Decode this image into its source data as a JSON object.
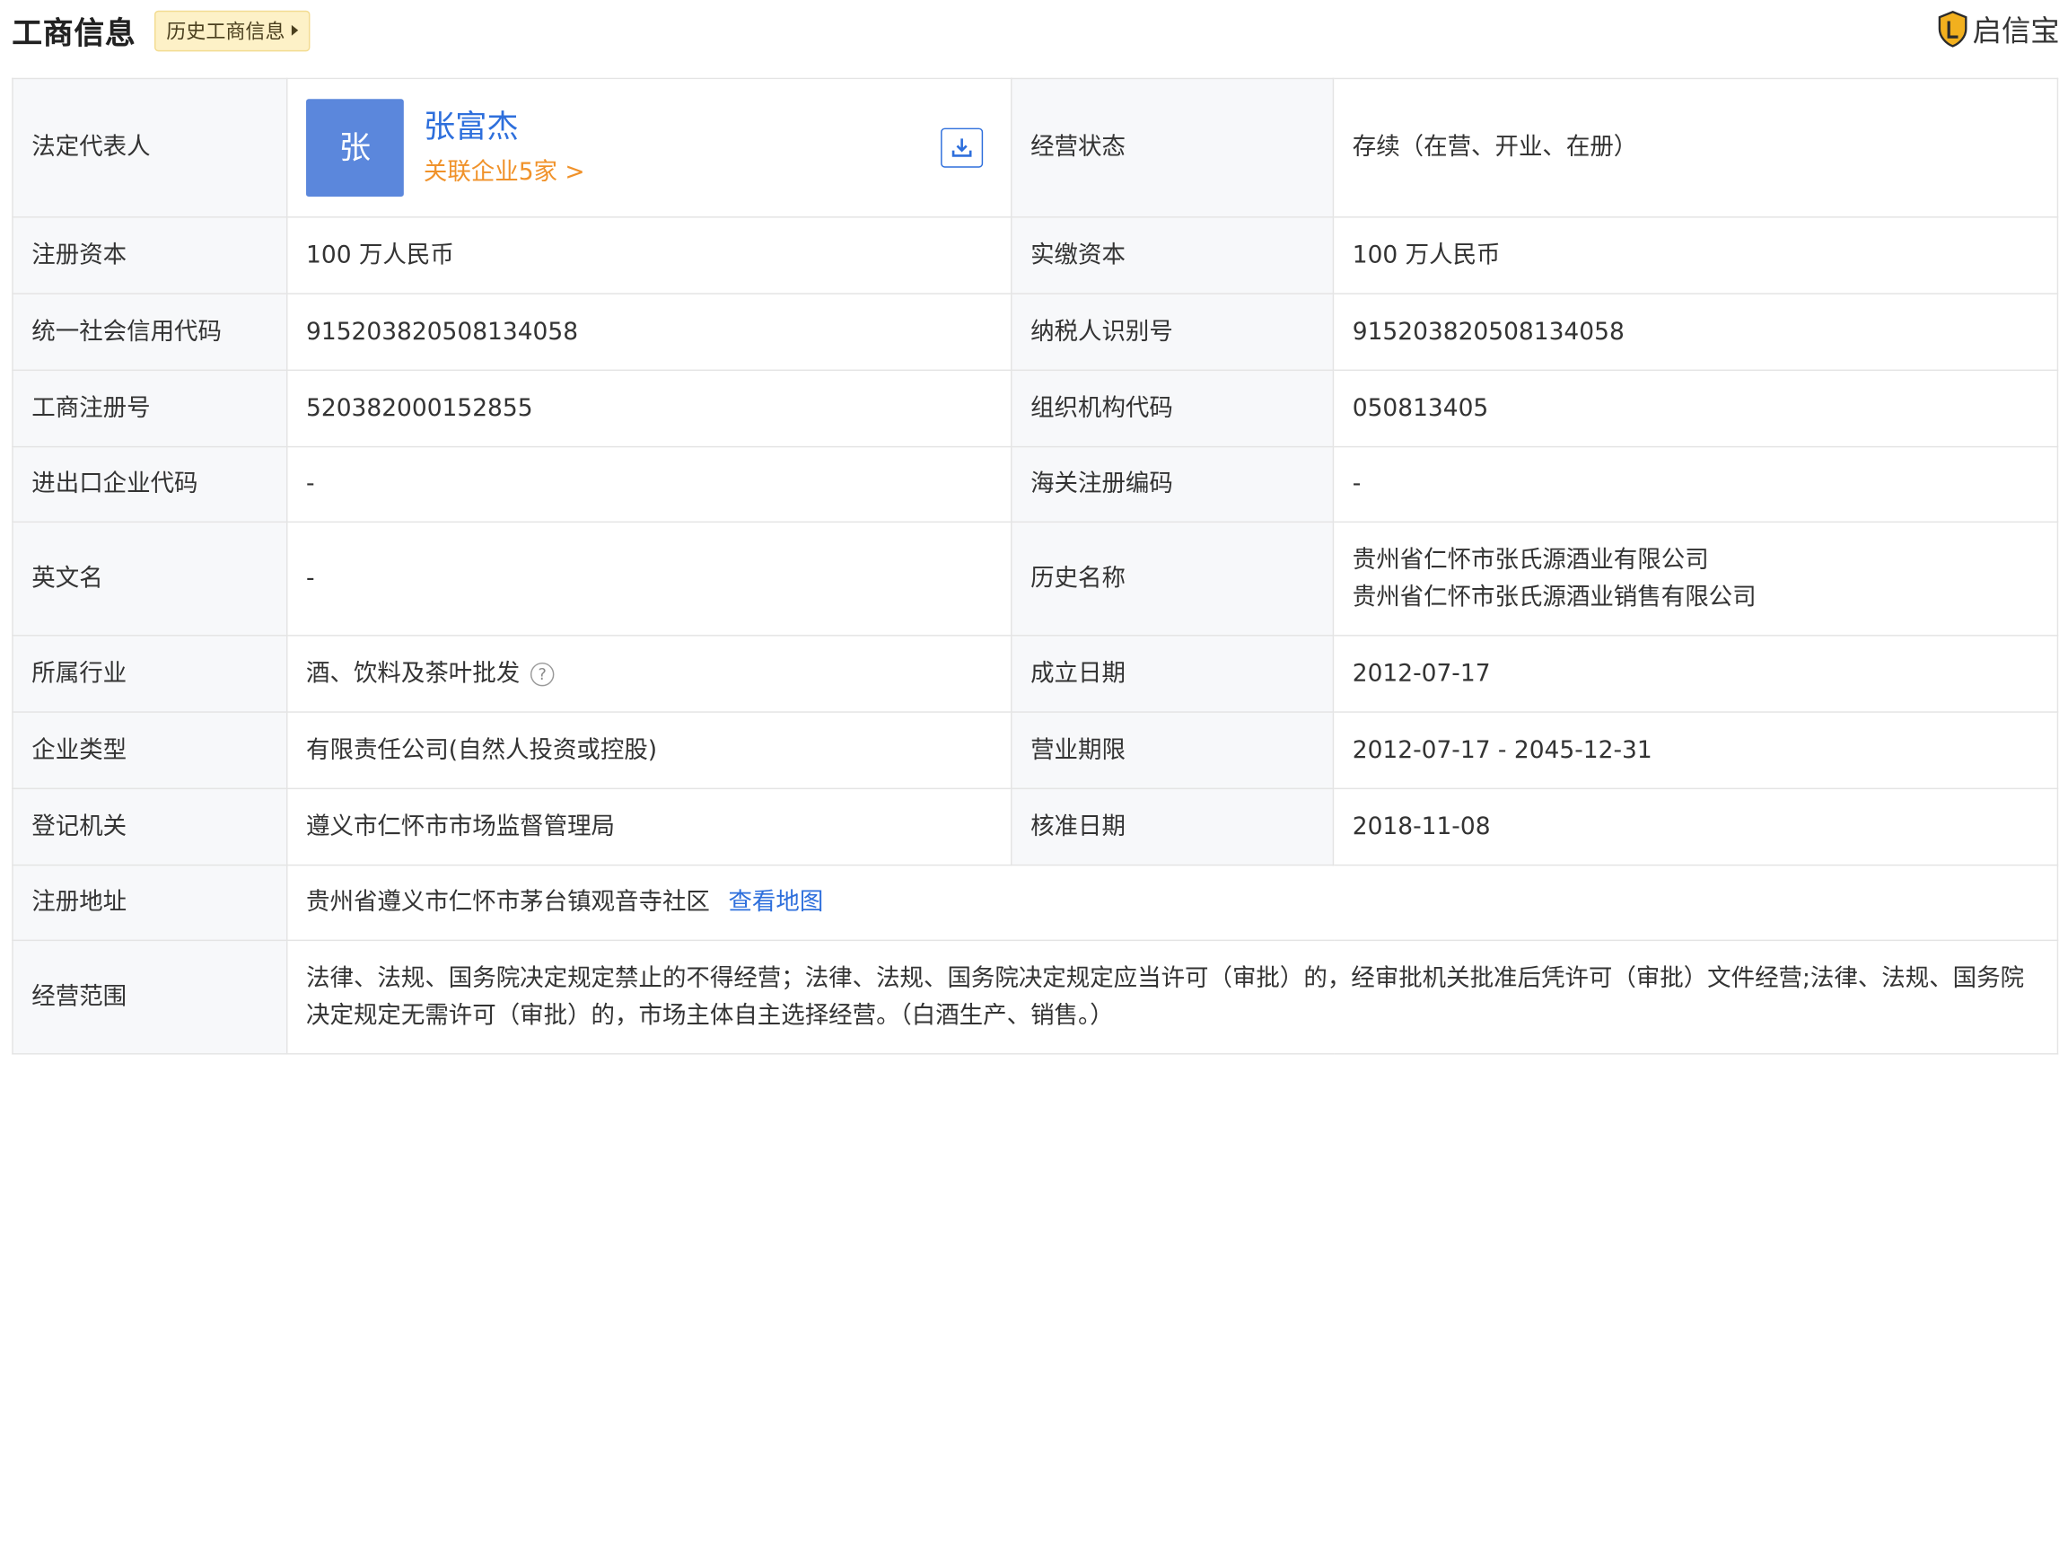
{
  "header": {
    "title": "工商信息",
    "history_tag": "历史工商信息",
    "brand": "启信宝"
  },
  "legal_rep": {
    "label": "法定代表人",
    "avatar_char": "张",
    "name": "张富杰",
    "related": "关联企业5家 >"
  },
  "rows": {
    "status_label": "经营状态",
    "status_value": "存续（在营、开业、在册）",
    "reg_capital_label": "注册资本",
    "reg_capital_value": "100 万人民币",
    "paid_capital_label": "实缴资本",
    "paid_capital_value": "100 万人民币",
    "credit_code_label": "统一社会信用代码",
    "credit_code_value": "915203820508134058",
    "taxpayer_label": "纳税人识别号",
    "taxpayer_value": "915203820508134058",
    "biz_reg_no_label": "工商注册号",
    "biz_reg_no_value": "520382000152855",
    "org_code_label": "组织机构代码",
    "org_code_value": "050813405",
    "import_export_label": "进出口企业代码",
    "import_export_value": "-",
    "customs_label": "海关注册编码",
    "customs_value": "-",
    "english_name_label": "英文名",
    "english_name_value": "-",
    "history_names_label": "历史名称",
    "history_names": [
      "贵州省仁怀市张氏源酒业有限公司",
      "贵州省仁怀市张氏源酒业销售有限公司"
    ],
    "industry_label": "所属行业",
    "industry_value": "酒、饮料及茶叶批发",
    "founded_label": "成立日期",
    "founded_value": "2012-07-17",
    "company_type_label": "企业类型",
    "company_type_value": "有限责任公司(自然人投资或控股)",
    "term_label": "营业期限",
    "term_value": "2012-07-17 - 2045-12-31",
    "authority_label": "登记机关",
    "authority_value": "遵义市仁怀市市场监督管理局",
    "approval_label": "核准日期",
    "approval_value": "2018-11-08",
    "address_label": "注册地址",
    "address_value": "贵州省遵义市仁怀市茅台镇观音寺社区",
    "map_link": "查看地图",
    "scope_label": "经营范围",
    "scope_value": "法律、法规、国务院决定规定禁止的不得经营；法律、法规、国务院决定规定应当许可（审批）的，经审批机关批准后凭许可（审批）文件经营;法律、法规、国务院决定规定无需许可（审批）的，市场主体自主选择经营。（白酒生产、销售。）"
  },
  "icons": {
    "download": "download-icon",
    "help": "question-circle-icon",
    "brand_logo": "shield-logo-icon"
  },
  "colors": {
    "link_blue": "#2e6fdc",
    "orange": "#f0922a",
    "avatar_bg": "#5b87dc",
    "tag_bg": "#fdf1c7",
    "label_bg": "#f7f8fa"
  }
}
